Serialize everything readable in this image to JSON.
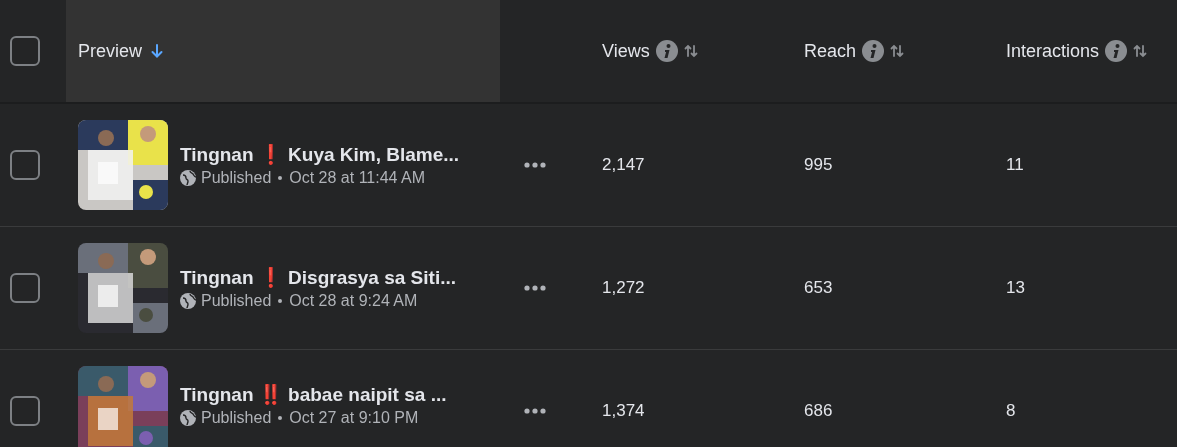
{
  "table": {
    "header_checkbox": {
      "checked": false
    },
    "columns": [
      {
        "label": "Preview",
        "sorted": true,
        "info": false
      },
      {
        "label": "Views",
        "sorted": false,
        "info": true
      },
      {
        "label": "Reach",
        "sorted": false,
        "info": true
      },
      {
        "label": "Interactions",
        "sorted": false,
        "info": true
      }
    ],
    "rows": [
      {
        "checked": false,
        "title": "Tingnan ❗ Kuya Kim, Blame...",
        "status": "Published",
        "date": "Oct 28 at 11:44 AM",
        "views": "2,147",
        "reach": "995",
        "interactions": "11"
      },
      {
        "checked": false,
        "title": "Tingnan ❗ Disgrasya sa Siti...",
        "status": "Published",
        "date": "Oct 28 at 9:24 AM",
        "views": "1,272",
        "reach": "653",
        "interactions": "13"
      },
      {
        "checked": false,
        "title": "Tingnan ‼️  babae naipit sa ...",
        "status": "Published",
        "date": "Oct 27 at 9:10 PM",
        "views": "1,374",
        "reach": "686",
        "interactions": "8"
      }
    ]
  }
}
